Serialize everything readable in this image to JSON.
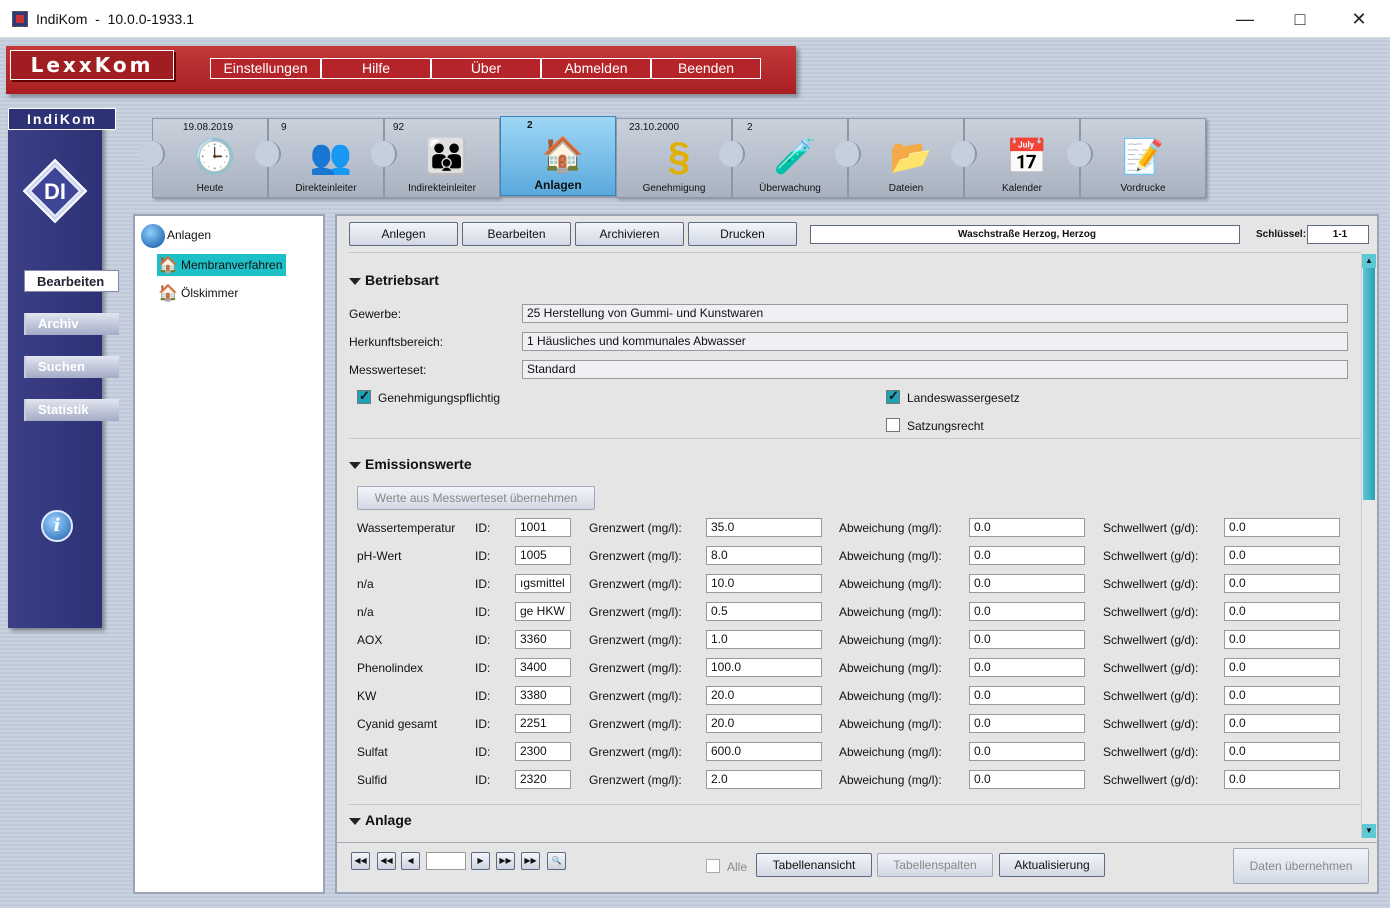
{
  "window": {
    "app_name": "IndiKom",
    "separator": "-",
    "version": "10.0.0-1933.1"
  },
  "top_menu": {
    "logo": "LexxKom",
    "items": [
      "Einstellungen",
      "Hilfe",
      "Über",
      "Abmelden",
      "Beenden"
    ]
  },
  "sidebar": {
    "logo": "IndiKom",
    "di_logo": "DI",
    "items": [
      "Bearbeiten",
      "Archiv",
      "Suchen",
      "Statistik"
    ],
    "active": "Bearbeiten"
  },
  "toolbar": {
    "items": [
      {
        "label": "Heute",
        "count": "19.08.2019",
        "icon": "clock-icon"
      },
      {
        "label": "Direkteinleiter",
        "count": "9",
        "icon": "direct-discharger-icon"
      },
      {
        "label": "Indirekteinleiter",
        "count": "92",
        "icon": "indirect-discharger-icon"
      },
      {
        "label": "Anlagen",
        "count": "2",
        "icon": "house-icon"
      },
      {
        "label": "Genehmigung",
        "count": "23.10.2000",
        "icon": "paragraph-icon"
      },
      {
        "label": "Überwachung",
        "count": "2",
        "icon": "lab-icon"
      },
      {
        "label": "Dateien",
        "count": "",
        "icon": "folder-icon"
      },
      {
        "label": "Kalender",
        "count": "",
        "icon": "calendar-icon"
      },
      {
        "label": "Vordrucke",
        "count": "",
        "icon": "form-icon"
      }
    ],
    "active": "Anlagen"
  },
  "tree": {
    "root": "Anlagen",
    "children": [
      "Membranverfahren",
      "Ölskimmer"
    ],
    "selected": "Membranverfahren"
  },
  "actions": {
    "buttons": [
      "Anlegen",
      "Bearbeiten",
      "Archivieren",
      "Drucken"
    ],
    "record_name": "Waschstraße Herzog, Herzog",
    "key_label": "Schlüssel:",
    "key_value": "1-1"
  },
  "betriebsart": {
    "title": "Betriebsart",
    "gewerbe_label": "Gewerbe:",
    "gewerbe_value": "25 Herstellung von Gummi- und Kunstwaren",
    "herkunft_label": "Herkunftsbereich:",
    "herkunft_value": "1 Häusliches und kommunales Abwasser",
    "messwerteset_label": "Messwerteset:",
    "messwerteset_value": "Standard",
    "cb_genehmigung": "Genehmigungspflichtig",
    "cb_genehmigung_checked": true,
    "cb_landeswasser": "Landeswassergesetz",
    "cb_landeswasser_checked": true,
    "cb_satzung": "Satzungsrecht",
    "cb_satzung_checked": false
  },
  "emission": {
    "title": "Emissionswerte",
    "take_button": "Werte aus Messwerteset übernehmen",
    "id_label": "ID:",
    "limit_label": "Grenzwert (mg/l):",
    "dev_label": "Abweichung (mg/l):",
    "threshold_label": "Schwellwert (g/d):",
    "rows": [
      {
        "name": "Wassertemperatur",
        "id": "1001",
        "limit": "35.0",
        "dev": "0.0",
        "threshold": "0.0"
      },
      {
        "name": "pH-Wert",
        "id": "1005",
        "limit": "8.0",
        "dev": "0.0",
        "threshold": "0.0"
      },
      {
        "name": "n/a",
        "id": "ıgsmittel",
        "limit": "10.0",
        "dev": "0.0",
        "threshold": "0.0"
      },
      {
        "name": "n/a",
        "id": "ge HKW",
        "limit": "0.5",
        "dev": "0.0",
        "threshold": "0.0"
      },
      {
        "name": "AOX",
        "id": "3360",
        "limit": "1.0",
        "dev": "0.0",
        "threshold": "0.0"
      },
      {
        "name": "Phenolindex",
        "id": "3400",
        "limit": "100.0",
        "dev": "0.0",
        "threshold": "0.0"
      },
      {
        "name": "KW",
        "id": "3380",
        "limit": "20.0",
        "dev": "0.0",
        "threshold": "0.0"
      },
      {
        "name": "Cyanid gesamt",
        "id": "2251",
        "limit": "20.0",
        "dev": "0.0",
        "threshold": "0.0"
      },
      {
        "name": "Sulfat",
        "id": "2300",
        "limit": "600.0",
        "dev": "0.0",
        "threshold": "0.0"
      },
      {
        "name": "Sulfid",
        "id": "2320",
        "limit": "2.0",
        "dev": "0.0",
        "threshold": "0.0"
      }
    ]
  },
  "anlage": {
    "title": "Anlage"
  },
  "bottom": {
    "page_value": "",
    "cb_alle": "Alle",
    "cb_alle_checked": false,
    "btn_table_view": "Tabellenansicht",
    "btn_table_columns": "Tabellenspalten",
    "btn_refresh": "Aktualisierung",
    "btn_apply": "Daten übernehmen"
  }
}
